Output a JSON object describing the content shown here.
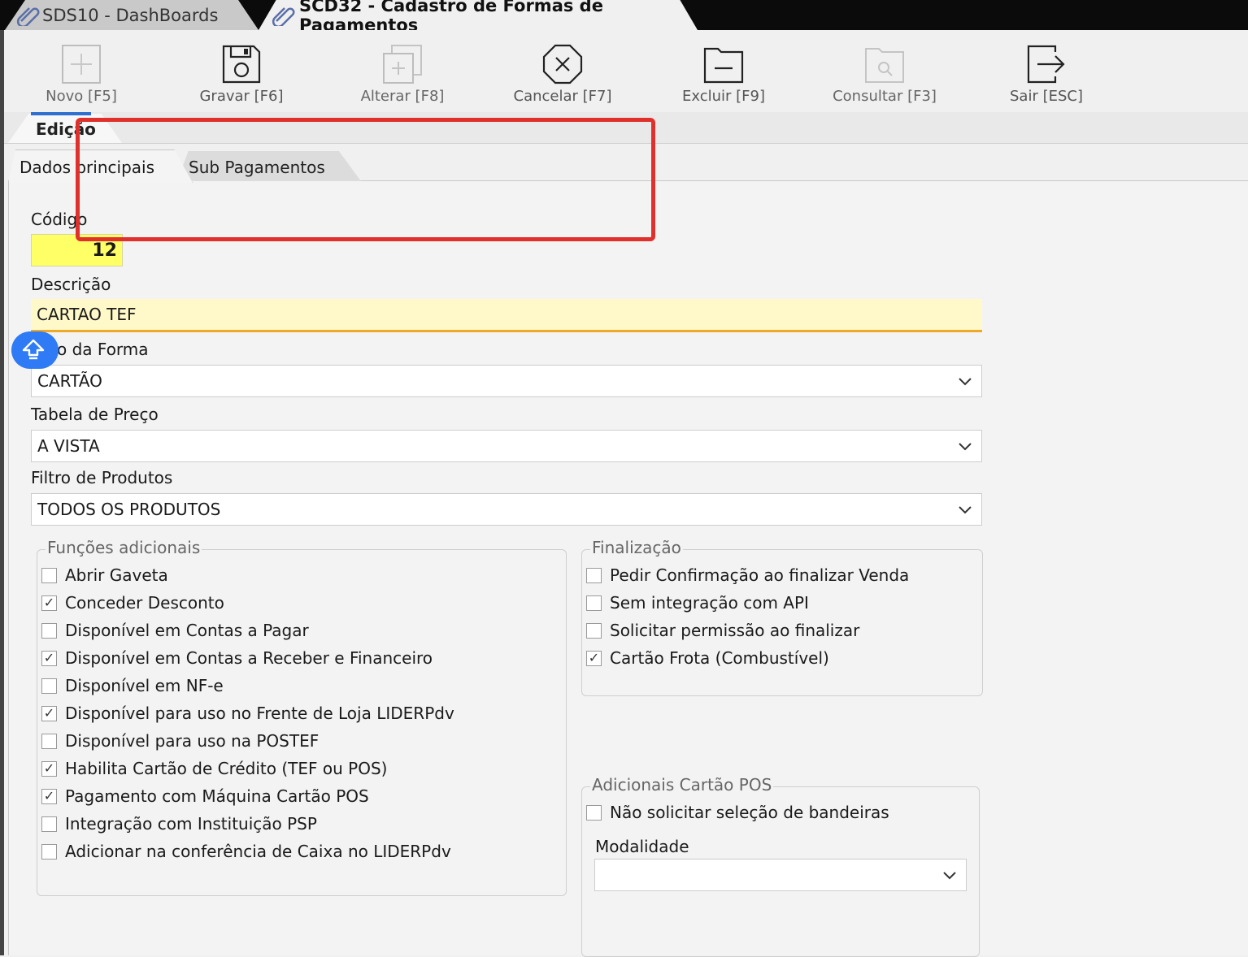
{
  "window_tabs": [
    {
      "label": "SDS10 - DashBoards"
    },
    {
      "label": "SCD32 - Cadastro de Formas de Pagamentos"
    }
  ],
  "toolbar": {
    "novo": "Novo [F5]",
    "gravar": "Gravar [F6]",
    "alterar": "Alterar [F8]",
    "cancelar": "Cancelar [F7]",
    "excluir": "Excluir [F9]",
    "consultar": "Consultar [F3]",
    "sair": "Sair [ESC]"
  },
  "edicao_tab": "Edição",
  "sub_tabs": {
    "dados": "Dados principais",
    "sub_pagamentos": "Sub Pagamentos"
  },
  "form": {
    "codigo_label": "Código",
    "codigo_value": "12",
    "descricao_label": "Descrição",
    "descricao_value": "CARTAO TEF",
    "tipo_label_visible": "o da Forma",
    "tipo_value": "CARTÃO",
    "tabela_label": "Tabela de Preço",
    "tabela_value": "A VISTA",
    "filtro_label": "Filtro de Produtos",
    "filtro_value": "TODOS OS PRODUTOS"
  },
  "funcoes": {
    "title": "Funções adicionais",
    "items": [
      {
        "label": "Abrir Gaveta",
        "checked": false
      },
      {
        "label": "Conceder Desconto",
        "checked": true
      },
      {
        "label": "Disponível em Contas a Pagar",
        "checked": false
      },
      {
        "label": "Disponível em Contas a Receber e Financeiro",
        "checked": true
      },
      {
        "label": "Disponível em NF-e",
        "checked": false
      },
      {
        "label": "Disponível para uso no Frente de Loja LIDERPdv",
        "checked": true
      },
      {
        "label": "Disponível para uso na POSTEF",
        "checked": false
      },
      {
        "label": "Habilita Cartão de Crédito (TEF ou POS)",
        "checked": true
      },
      {
        "label": "Pagamento com Máquina Cartão POS",
        "checked": true
      },
      {
        "label": "Integração com Instituição PSP",
        "checked": false
      },
      {
        "label": "Adicionar na conferência de Caixa no LIDERPdv",
        "checked": false
      }
    ]
  },
  "finalizacao": {
    "title": "Finalização",
    "items": [
      {
        "label": "Pedir Confirmação ao finalizar Venda",
        "checked": false
      },
      {
        "label": "Sem integração com API",
        "checked": false
      },
      {
        "label": "Solicitar permissão ao finalizar",
        "checked": false
      },
      {
        "label": "Cartão Frota (Combustível)",
        "checked": true
      }
    ]
  },
  "adicionais_pos": {
    "title": "Adicionais Cartão POS",
    "nao_solicitar": {
      "label": "Não solicitar seleção de bandeiras",
      "checked": false
    },
    "modalidade_label": "Modalidade",
    "modalidade_value": ""
  },
  "colors": {
    "highlight_red": "#e0302c",
    "codigo_bg": "#ffff66",
    "descricao_bg": "#fff8c8",
    "accent_blue": "#2f7bf5"
  }
}
